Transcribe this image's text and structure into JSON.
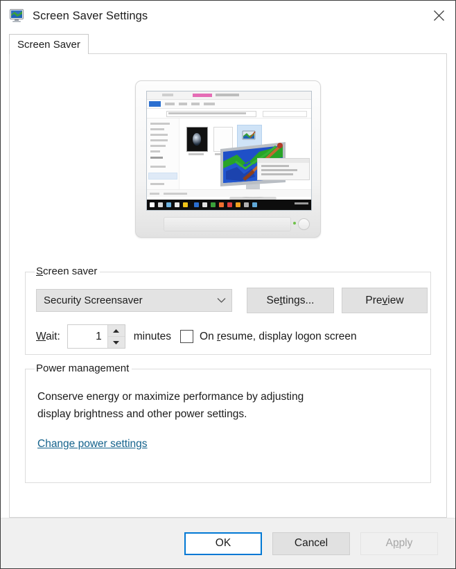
{
  "window": {
    "title": "Screen Saver Settings",
    "icon": "screen-saver-monitor-icon",
    "close_label": "✕"
  },
  "tabs": [
    {
      "label": "Screen Saver",
      "selected": true
    }
  ],
  "preview": {
    "alt": "monitor-preview-showing-file-explorer-with-screensaver-icon"
  },
  "screen_saver_group": {
    "title_pre": "S",
    "title_rest": "creen saver",
    "dropdown": {
      "value": "Security Screensaver",
      "chevron": "chevron-down-icon"
    },
    "settings_button": {
      "pre": "Se",
      "acc": "t",
      "post": "tings..."
    },
    "preview_button": {
      "pre": "Pre",
      "acc": "v",
      "post": "iew"
    },
    "wait": {
      "pre": "W",
      "acc": "a",
      "post": "it:"
    },
    "wait_value": "1",
    "minutes_label": "minutes",
    "on_resume": {
      "checked": false,
      "pre": "On ",
      "acc": "r",
      "post": "esume, display logon screen"
    }
  },
  "power_group": {
    "title": "Power management",
    "description_line1": "Conserve energy or maximize performance by adjusting",
    "description_line2": "display brightness and other power settings.",
    "link": "Change power settings"
  },
  "footer": {
    "ok_label": "OK",
    "cancel_label": "Cancel",
    "apply_pre": "A",
    "apply_acc": "p",
    "apply_post": "ply",
    "apply_disabled": true
  },
  "colors": {
    "accent": "#0078d4",
    "link": "#14628c",
    "button_face": "#e1e1e1",
    "footer_bg": "#f0f0f0",
    "text": "#1b1b1b",
    "disabled_text": "#a6a6a6"
  }
}
